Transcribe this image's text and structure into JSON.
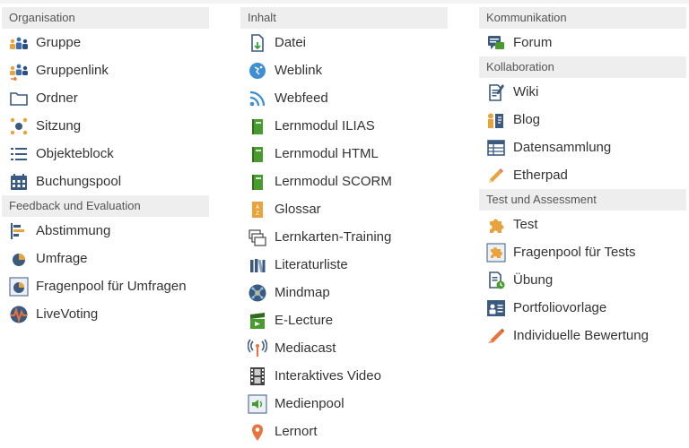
{
  "columns": [
    {
      "groups": [
        {
          "title": "Organisation",
          "items": [
            {
              "label": "Gruppe",
              "icon": "group-icon"
            },
            {
              "label": "Gruppenlink",
              "icon": "group-link-icon"
            },
            {
              "label": "Ordner",
              "icon": "folder-icon"
            },
            {
              "label": "Sitzung",
              "icon": "session-icon"
            },
            {
              "label": "Objekteblock",
              "icon": "list-icon"
            },
            {
              "label": "Buchungspool",
              "icon": "calendar-icon"
            }
          ]
        },
        {
          "title": "Feedback und Evaluation",
          "items": [
            {
              "label": "Abstimmung",
              "icon": "poll-icon"
            },
            {
              "label": "Umfrage",
              "icon": "survey-icon"
            },
            {
              "label": "Fragenpool für Umfragen",
              "icon": "survey-pool-icon"
            },
            {
              "label": "LiveVoting",
              "icon": "live-voting-icon"
            }
          ]
        }
      ]
    },
    {
      "groups": [
        {
          "title": "Inhalt",
          "items": [
            {
              "label": "Datei",
              "icon": "file-icon"
            },
            {
              "label": "Weblink",
              "icon": "weblink-icon"
            },
            {
              "label": "Webfeed",
              "icon": "rss-icon"
            },
            {
              "label": "Lernmodul ILIAS",
              "icon": "book-icon"
            },
            {
              "label": "Lernmodul HTML",
              "icon": "book-icon"
            },
            {
              "label": "Lernmodul SCORM",
              "icon": "book-icon"
            },
            {
              "label": "Glossar",
              "icon": "glossary-icon"
            },
            {
              "label": "Lernkarten-Training",
              "icon": "flashcards-icon"
            },
            {
              "label": "Literaturliste",
              "icon": "library-icon"
            },
            {
              "label": "Mindmap",
              "icon": "mindmap-icon"
            },
            {
              "label": "E-Lecture",
              "icon": "clapper-icon"
            },
            {
              "label": "Mediacast",
              "icon": "broadcast-icon"
            },
            {
              "label": "Interaktives Video",
              "icon": "film-icon"
            },
            {
              "label": "Medienpool",
              "icon": "media-pool-icon"
            },
            {
              "label": "Lernort",
              "icon": "map-pin-icon"
            }
          ]
        }
      ]
    },
    {
      "groups": [
        {
          "title": "Kommunikation",
          "items": [
            {
              "label": "Forum",
              "icon": "forum-icon"
            }
          ]
        },
        {
          "title": "Kollaboration",
          "items": [
            {
              "label": "Wiki",
              "icon": "wiki-icon"
            },
            {
              "label": "Blog",
              "icon": "blog-icon"
            },
            {
              "label": "Datensammlung",
              "icon": "table-icon"
            },
            {
              "label": "Etherpad",
              "icon": "pencil-icon"
            }
          ]
        },
        {
          "title": "Test und Assessment",
          "items": [
            {
              "label": "Test",
              "icon": "puzzle-icon"
            },
            {
              "label": "Fragenpool für Tests",
              "icon": "puzzle-pool-icon"
            },
            {
              "label": "Übung",
              "icon": "exercise-icon"
            },
            {
              "label": "Portfoliovorlage",
              "icon": "portfolio-icon"
            },
            {
              "label": "Individuelle Bewertung",
              "icon": "marker-icon"
            }
          ]
        }
      ]
    }
  ]
}
